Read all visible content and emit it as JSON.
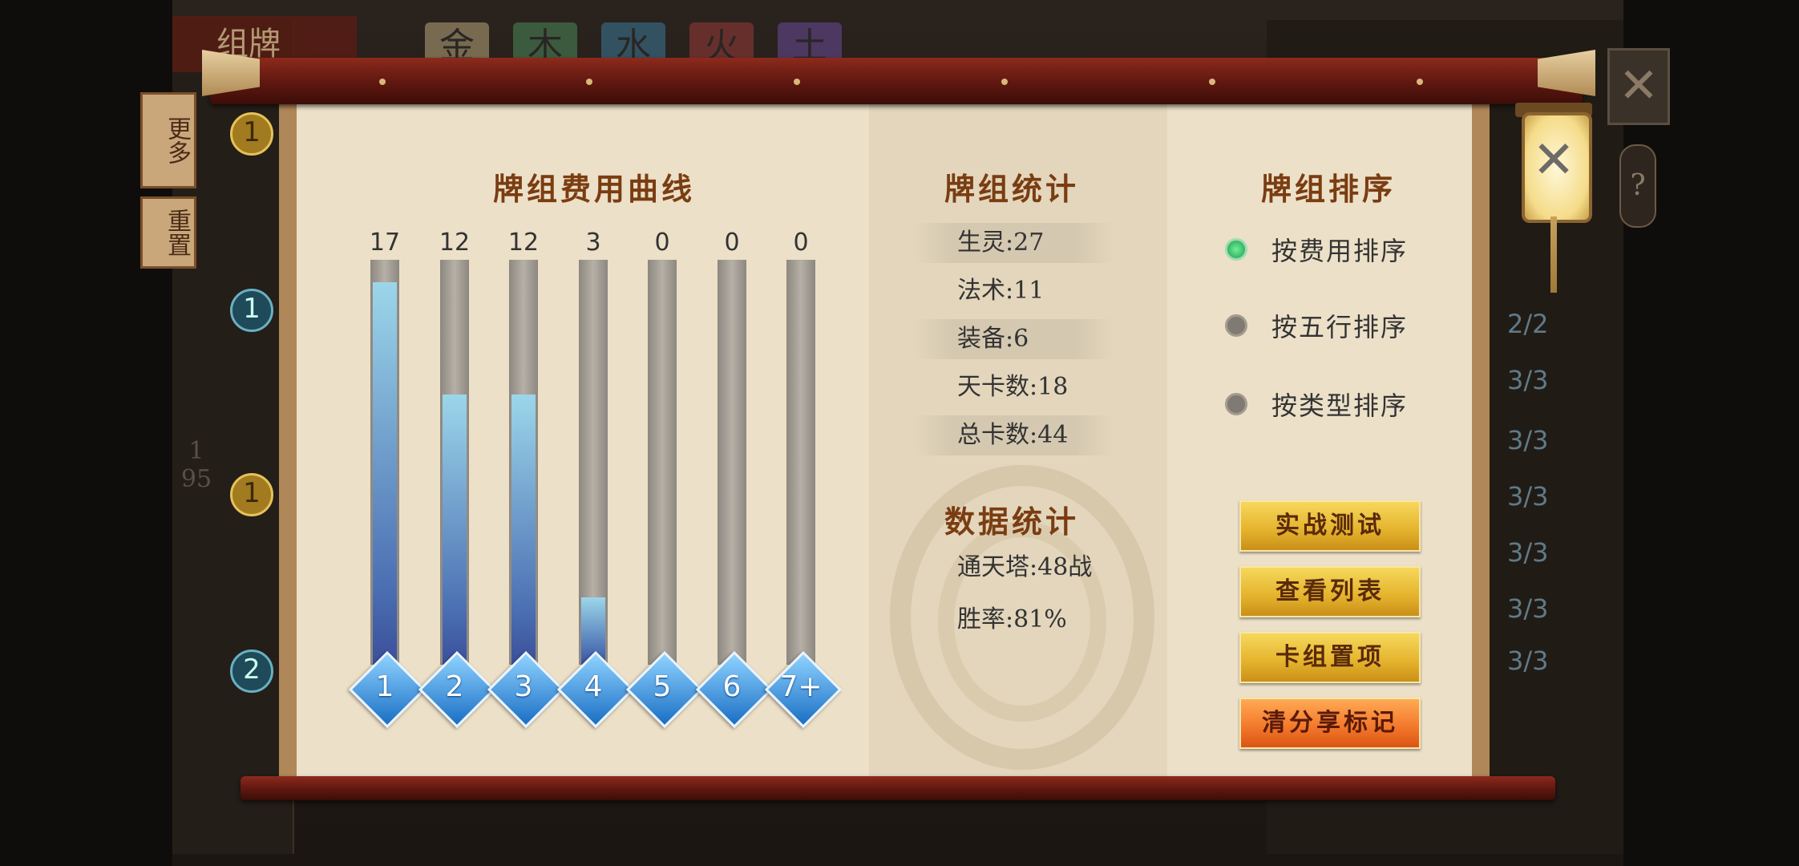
{
  "background": {
    "title": "组牌",
    "element_tabs": [
      "金",
      "木",
      "水",
      "火",
      "土"
    ],
    "side_buttons": [
      "更多",
      "重置"
    ],
    "card_counts": [
      "2/2",
      "3/3",
      "3/3",
      "3/3",
      "3/3",
      "3/3",
      "3/3"
    ],
    "page_indicator": [
      "1",
      "95"
    ]
  },
  "cost_curve": {
    "title": "牌组费用曲线",
    "bars": [
      {
        "cost": "1",
        "count": 17
      },
      {
        "cost": "2",
        "count": 12
      },
      {
        "cost": "3",
        "count": 12
      },
      {
        "cost": "4",
        "count": 3
      },
      {
        "cost": "5",
        "count": 0
      },
      {
        "cost": "6",
        "count": 0
      },
      {
        "cost": "7+",
        "count": 0
      }
    ],
    "max_count": 18
  },
  "deck_stats": {
    "title": "牌组统计",
    "items": [
      "生灵:27",
      "法术:11",
      "装备:6",
      "天卡数:18",
      "总卡数:44"
    ]
  },
  "data_stats": {
    "title": "数据统计",
    "items": [
      "通天塔:48战",
      "胜率:81%"
    ]
  },
  "sort": {
    "title": "牌组排序",
    "options": [
      {
        "label": "按费用排序",
        "selected": true
      },
      {
        "label": "按五行排序",
        "selected": false
      },
      {
        "label": "按类型排序",
        "selected": false
      }
    ]
  },
  "actions": {
    "battle_test": "实战测试",
    "view_list": "查看列表",
    "pin_deck": "卡组置项",
    "clear_share": "清分享标记"
  },
  "icons": {
    "close": "close-icon",
    "help": "help-icon"
  },
  "colors": {
    "accent_gold": "#e4b22c",
    "accent_red": "#f2762a",
    "title_brown": "#7a3d12",
    "bar_blue": "#4b6fb2"
  }
}
